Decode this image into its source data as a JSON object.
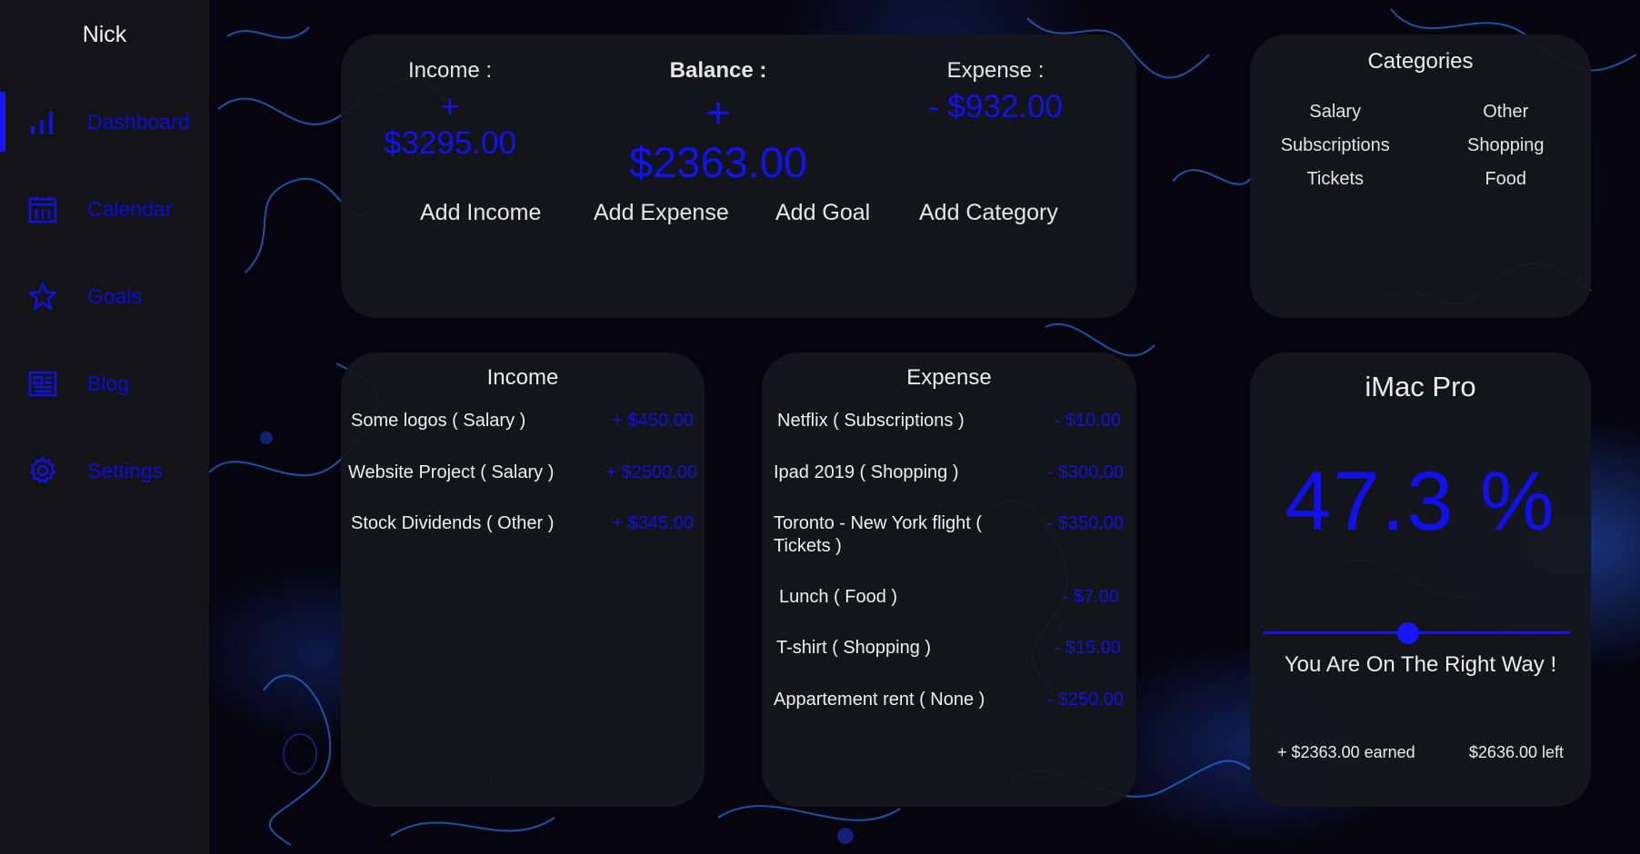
{
  "user": {
    "name": "Nick"
  },
  "nav": {
    "items": [
      {
        "label": "Dashboard",
        "icon": "bar-chart-icon",
        "active": true
      },
      {
        "label": "Calendar",
        "icon": "calendar-icon",
        "active": false
      },
      {
        "label": "Goals",
        "icon": "star-icon",
        "active": false
      },
      {
        "label": "Blog",
        "icon": "newspaper-icon",
        "active": false
      },
      {
        "label": "Settings",
        "icon": "gear-icon",
        "active": false
      }
    ]
  },
  "summary": {
    "income_label": "Income :",
    "income_value": "+ $3295.00",
    "balance_label": "Balance :",
    "balance_value": "+ $2363.00",
    "expense_label": "Expense :",
    "expense_value": "- $932.00",
    "actions": [
      "Add Income",
      "Add Expense",
      "Add Goal",
      "Add Category"
    ]
  },
  "categories": {
    "title": "Categories",
    "items": [
      "Salary",
      "Other",
      "Subscriptions",
      "Shopping",
      "Tickets",
      "Food"
    ]
  },
  "income": {
    "title": "Income",
    "rows": [
      {
        "name": "Some logos ( Salary )",
        "amount": "+ $450.00"
      },
      {
        "name": "Website Project ( Salary )",
        "amount": "+ $2500.00"
      },
      {
        "name": "Stock Dividends ( Other )",
        "amount": "+ $345.00"
      }
    ]
  },
  "expense": {
    "title": "Expense",
    "rows": [
      {
        "name": "Netflix ( Subscriptions )",
        "amount": "- $10.00"
      },
      {
        "name": "Ipad 2019 ( Shopping )",
        "amount": "- $300.00"
      },
      {
        "name": "Toronto - New York flight ( Tickets )",
        "amount": "- $350.00"
      },
      {
        "name": "Lunch ( Food )",
        "amount": "- $7.00"
      },
      {
        "name": "T-shirt ( Shopping )",
        "amount": "- $15.00"
      },
      {
        "name": "Appartement rent ( None )",
        "amount": "- $250.00"
      }
    ]
  },
  "goal": {
    "title": "iMac Pro",
    "percent_text": "47.3 %",
    "progress": 0.473,
    "message": "You Are On The Right Way !",
    "earned": "+ $2363.00 earned",
    "left": "$2636.00 left"
  },
  "colors": {
    "accent": "#1515ff",
    "sidebar_bg": "#141418",
    "card_bg": "#16161c",
    "text": "#e8e8e8"
  }
}
